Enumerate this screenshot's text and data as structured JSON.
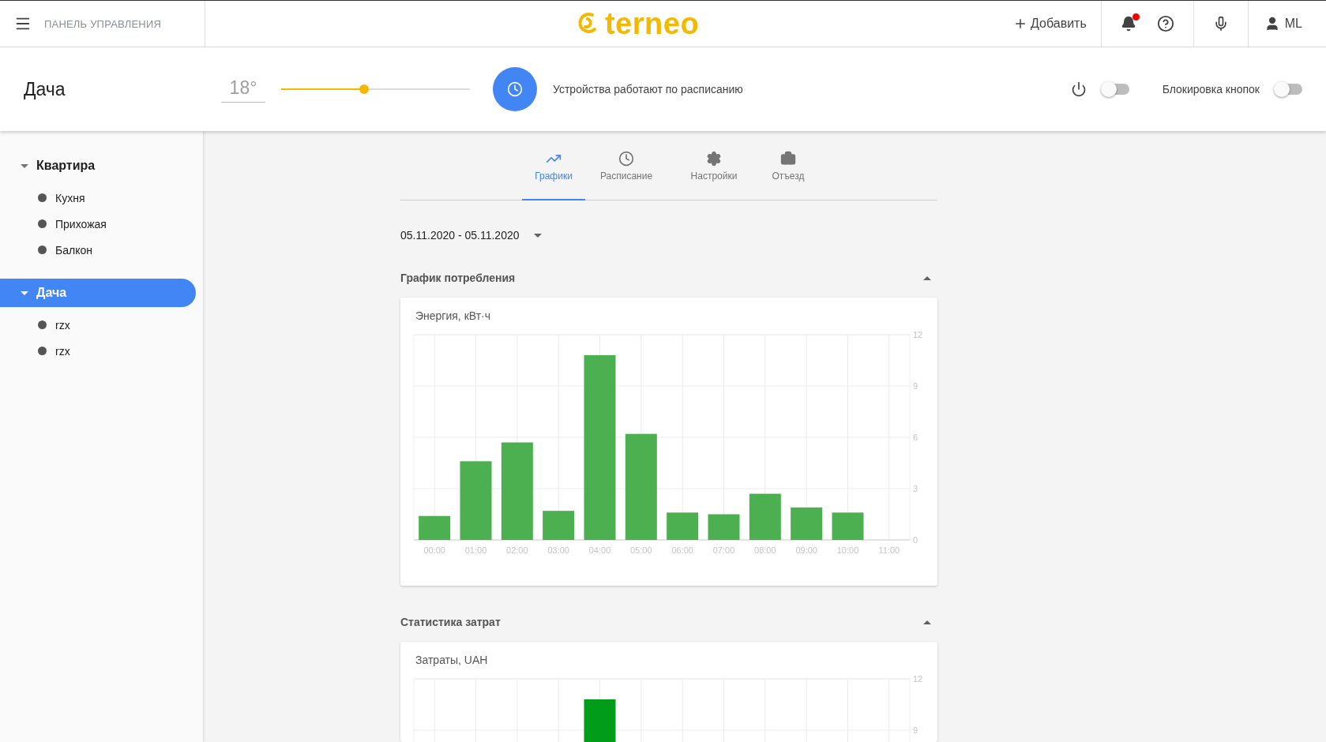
{
  "header": {
    "menu_label": "ПАНЕЛЬ УПРАВЛЕНИЯ",
    "logo": "terneo",
    "add_button": "Добавить",
    "notification_unread": true,
    "user": "ML"
  },
  "controls": {
    "title": "Дача",
    "temperature": "18°",
    "level": 0.44,
    "schedule_text": "Устройства работают по расписанию",
    "power_on": false,
    "lock_label": "Блокировка кнопок",
    "lock_on": false
  },
  "sidebar": {
    "groups": [
      {
        "label": "Квартира",
        "expanded": true,
        "selected": false,
        "children": [
          {
            "label": "Кухня"
          },
          {
            "label": "Прихожая"
          },
          {
            "label": "Балкон"
          }
        ]
      },
      {
        "label": "Дача",
        "expanded": true,
        "selected": true,
        "children": [
          {
            "label": "rzx"
          },
          {
            "label": "rzx"
          }
        ]
      }
    ]
  },
  "tabs": [
    {
      "label": "Графики",
      "kind": "charts",
      "selected": true
    },
    {
      "label": "Расписание",
      "kind": "schedule",
      "selected": false
    },
    {
      "label": "Настройки",
      "kind": "settings",
      "selected": false
    },
    {
      "label": "Отъезд",
      "kind": "away",
      "selected": false
    }
  ],
  "date_range": "05.11.2020 - 05.11.2020",
  "sections": [
    {
      "title": "График потребления",
      "expanded": true,
      "chart_data": {
        "type": "bar",
        "title": "Энергия, кВт·ч",
        "categories": [
          "00:00",
          "01:00",
          "02:00",
          "03:00",
          "04:00",
          "05:00",
          "06:00",
          "07:00",
          "08:00",
          "09:00",
          "10:00",
          "11:00"
        ],
        "ylim": [
          0,
          12
        ],
        "yticks": [
          0,
          3,
          6,
          9,
          12
        ],
        "grid": true,
        "series": [
          {
            "color": "#4caf50",
            "values": [
              1.4,
              4.6,
              5.7,
              1.7,
              10.8,
              6.2,
              1.6,
              1.5,
              2.7,
              1.9,
              1.6,
              null
            ]
          }
        ]
      }
    },
    {
      "title": "Статистика затрат",
      "expanded": true,
      "chart_data": {
        "type": "bar",
        "title": "Затраты, UAH",
        "ylim": [
          0,
          12
        ],
        "yticks": [
          9,
          12
        ],
        "grid": true,
        "series": [
          {
            "color": "#009c1a",
            "values": [
              null,
              null,
              null,
              null,
              10.8,
              null,
              null,
              null,
              null,
              null,
              null,
              null
            ]
          }
        ]
      }
    }
  ]
}
